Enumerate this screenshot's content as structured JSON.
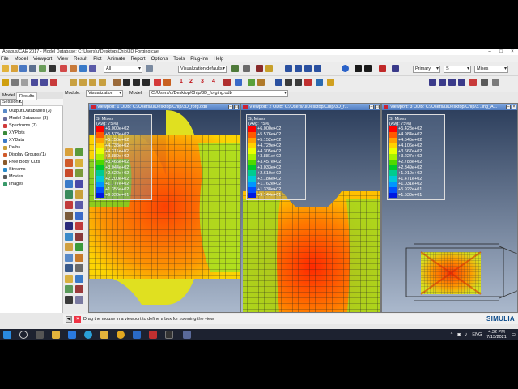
{
  "window": {
    "title": "Abaqus/CAE 2017 - Model Database: C:\\Users\\u\\Desktop\\Chip\\3D Forging.cae"
  },
  "menu": [
    "File",
    "Model",
    "Viewport",
    "View",
    "Result",
    "Plot",
    "Animate",
    "Report",
    "Options",
    "Tools",
    "Plug-ins",
    "Help"
  ],
  "toolbar": {
    "all_field": "All",
    "viz_defaults": "Visualization defaults",
    "primary": "Primary",
    "variable": "S",
    "invariant": "Mises",
    "numbers": [
      "1",
      "2",
      "3",
      "4"
    ]
  },
  "context": {
    "module_label": "Module:",
    "module_value": "Visualization",
    "model_label": "Model:",
    "model_value": "C:/Users/u/Desktop/Chip/3D_forging.odb"
  },
  "tree": {
    "tabs": [
      "Model",
      "Results"
    ],
    "session_label": "Session Dir",
    "items": [
      "Output Databases (3)",
      "Model Database (3)",
      "Spectrums (7)",
      "XYPlots",
      "XYData",
      "Paths",
      "Display Groups (1)",
      "Free Body Cuts",
      "Streams",
      "Movies",
      "Images"
    ]
  },
  "viewports": [
    {
      "title": "Viewport: 1    ODB: C:/Users/u/Desktop/Chip/3D_forg.odb",
      "legend_title": "S, Mises",
      "legend_avg": "(Avg: 75%)",
      "values": [
        "+6.000e+02",
        "+5.578e+02",
        "+5.155e+02",
        "+4.733e+02",
        "+4.311e+02",
        "+3.889e+02",
        "+3.466e+02",
        "+3.044e+02",
        "+2.622e+02",
        "+2.200e+02",
        "+1.777e+02",
        "+1.355e+02",
        "+9.330e+01"
      ]
    },
    {
      "title": "Viewport: 2    ODB: C:/Users/u/Desktop/Chip/3D_f...",
      "legend_title": "S, Mises",
      "legend_avg": "(Avg: 75%)",
      "values": [
        "+6.000e+02",
        "+5.576e+02",
        "+5.152e+02",
        "+4.729e+02",
        "+4.305e+02",
        "+3.881e+02",
        "+3.457e+02",
        "+3.033e+02",
        "+2.610e+02",
        "+2.186e+02",
        "+1.762e+02",
        "+1.338e+02",
        "+9.144e+01"
      ]
    },
    {
      "title": "Viewport: 3    ODB: C:/Users/u/Desktop/Chip/3...ing_A...",
      "legend_title": "S, Mises",
      "legend_avg": "(Avg: 75%)",
      "values": [
        "+5.423e+02",
        "+4.984e+02",
        "+4.545e+02",
        "+4.106e+02",
        "+3.667e+02",
        "+3.227e+02",
        "+2.788e+02",
        "+2.349e+02",
        "+1.910e+02",
        "+1.471e+02",
        "+1.031e+02",
        "+5.922e+01",
        "+1.530e+01"
      ]
    }
  ],
  "legend_colors": [
    "#ff0000",
    "#ff5a00",
    "#ffa000",
    "#ffd200",
    "#eaff00",
    "#a6f000",
    "#4fd800",
    "#00c82c",
    "#00cc90",
    "#00c8d8",
    "#0096ff",
    "#0050ff",
    "#0018e0"
  ],
  "prompt": {
    "message": "Drag the mouse in a viewport to define a box for zooming the view"
  },
  "brand": "SIMULIA",
  "taskbar": {
    "time": "4:32 PM",
    "date": "7/13/2021",
    "lang": "ENG"
  }
}
